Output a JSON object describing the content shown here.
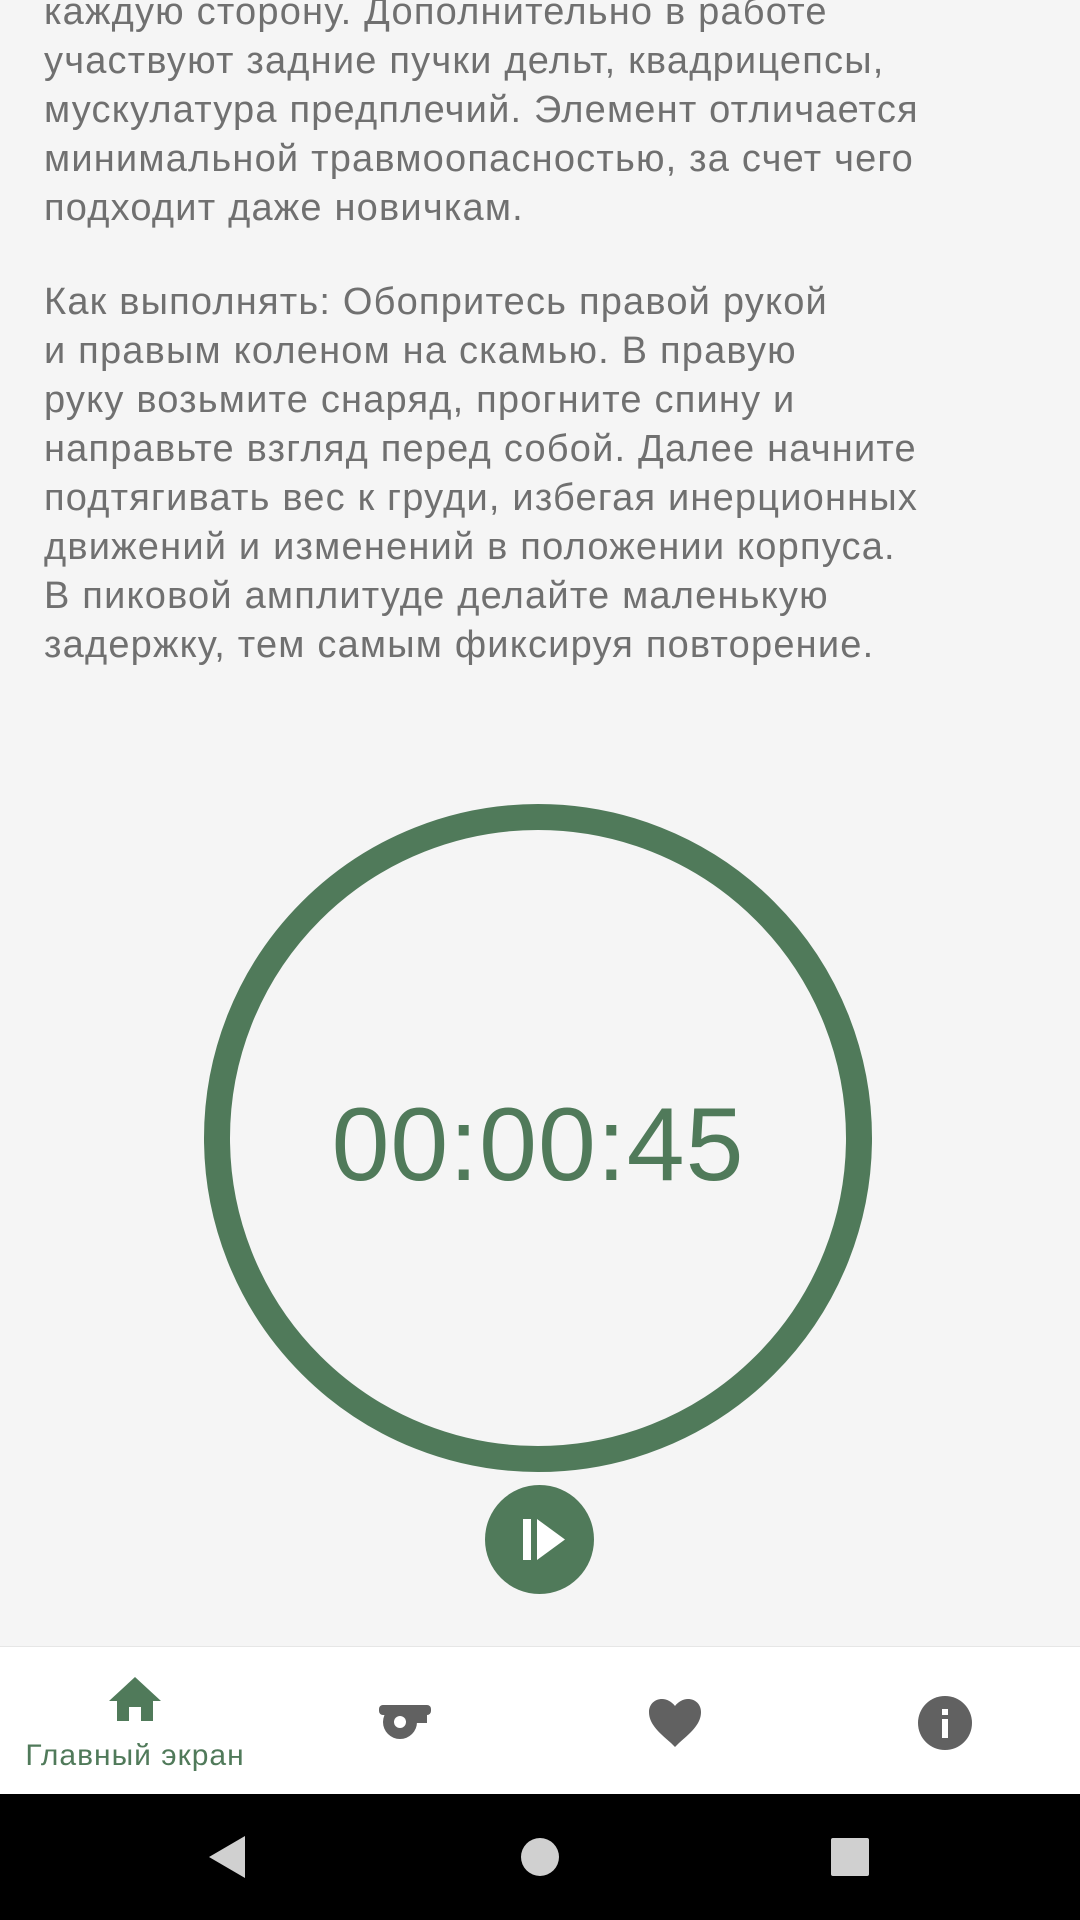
{
  "description": {
    "lines": [
      "каждую сторону. Дополнительно в работе",
      "участвуют задние пучки дельт, квадрицепсы,",
      "мускулатура предплечий. Элемент отличается",
      "минимальной травмоопасностью, за счет чего",
      "подходит даже новичкам."
    ]
  },
  "howto": {
    "lines": [
      "Как выполнять: Обопритесь правой рукой",
      "и правым коленом на скамью. В правую",
      "руку возьмите снаряд, прогните спину и",
      "направьте взгляд перед собой. Далее начните",
      "подтягивать вес к груди, избегая инерционных",
      "движений и изменений в положении корпуса.",
      "В пиковой амплитуде делайте маленькую",
      "задержку, тем самым фиксируя повторение."
    ]
  },
  "timer": {
    "display": "00:00:45",
    "ring_color": "#507a5a",
    "control_icon": "play-pause-icon"
  },
  "bottom_nav": {
    "items": [
      {
        "icon": "home-icon",
        "label": "Главный экран",
        "active": true
      },
      {
        "icon": "whistle-icon",
        "label": "",
        "active": false
      },
      {
        "icon": "heart-icon",
        "label": "",
        "active": false
      },
      {
        "icon": "info-icon",
        "label": "",
        "active": false
      }
    ],
    "active_color": "#507a5a",
    "inactive_color": "#616161"
  },
  "system_nav": {
    "buttons": [
      "back-icon",
      "home-circle-icon",
      "recents-icon"
    ]
  }
}
